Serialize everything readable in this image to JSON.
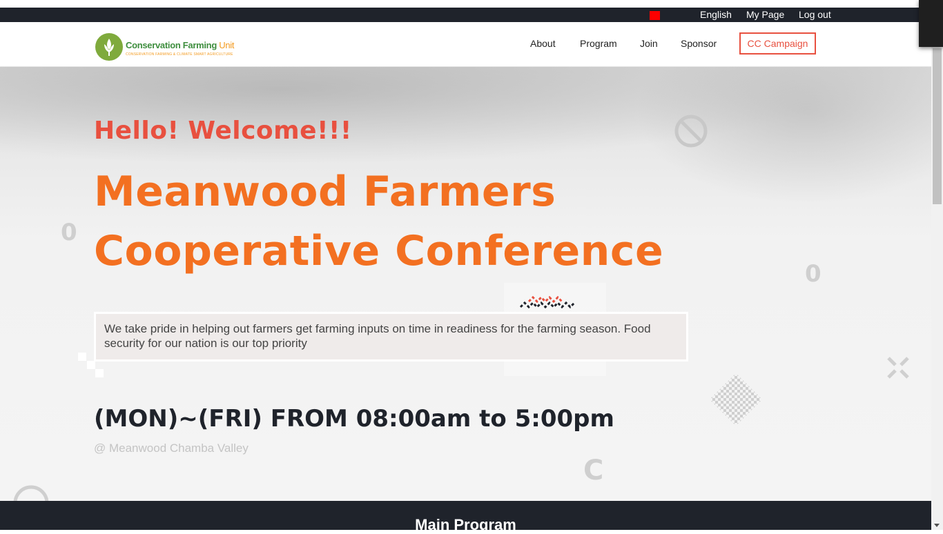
{
  "utility_bar": {
    "language": "English",
    "my_page": "My Page",
    "logout": "Log out"
  },
  "logo": {
    "brand_main": "Conservation Farming",
    "brand_unit": "Unit",
    "tagline": "CONSERVATION FARMING & CLIMATE SMART AGRICULTURE"
  },
  "nav": {
    "items": [
      "About",
      "Program",
      "Join",
      "Sponsor"
    ],
    "campaign": "CC Campaign"
  },
  "hero": {
    "greeting": "Hello! Welcome!!!",
    "headline_line1": "Meanwood Farmers",
    "headline_line2": "Cooperative Conference",
    "description": "We take pride in helping out farmers get farming inputs on time in readiness for the farming season. Food security for our nation is our top priority",
    "hours": "(MON)~(FRI) FROM 08:00am to 5:00pm",
    "location": "@ Meanwood Chamba Valley"
  },
  "footer": {
    "section_title": "Main Program"
  },
  "colors": {
    "accent_red": "#e8503f",
    "accent_orange": "#f37021",
    "dark": "#1f232b"
  }
}
